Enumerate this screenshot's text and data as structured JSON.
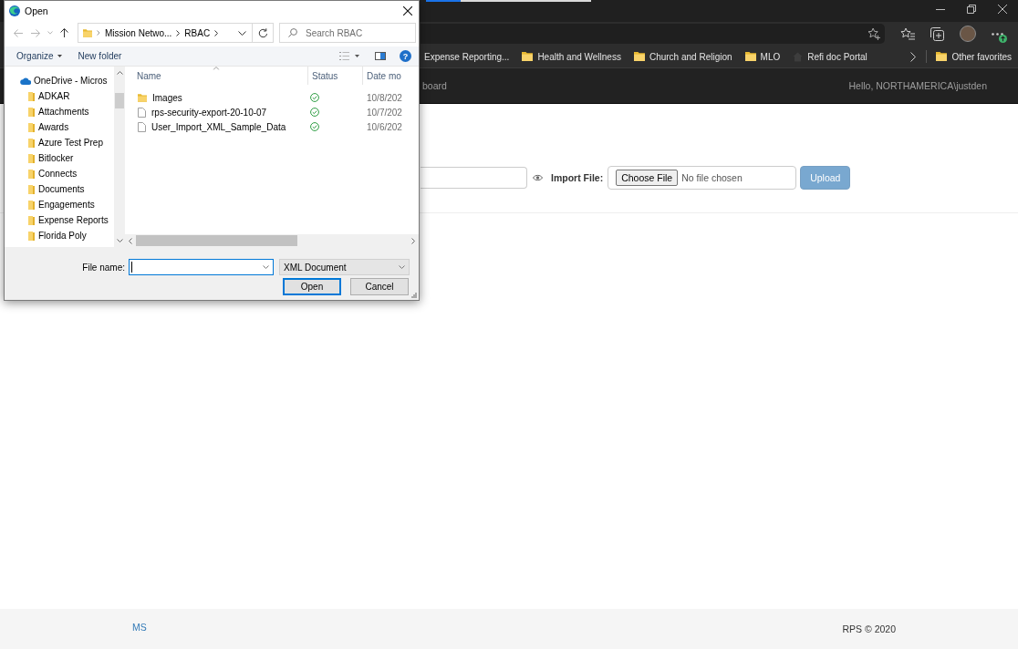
{
  "browser": {
    "loading_bar": {
      "level": 0.21
    },
    "favorites": [
      {
        "label": "Expense Reporting...",
        "kind": "link"
      },
      {
        "label": "Health and Wellness",
        "kind": "folder"
      },
      {
        "label": "Church and Religion",
        "kind": "folder"
      },
      {
        "label": "MLO",
        "kind": "folder"
      },
      {
        "label": "Refi doc Portal",
        "kind": "site"
      }
    ],
    "other_favorites": {
      "label": "Other favorites",
      "kind": "folder"
    }
  },
  "page": {
    "navbar": {
      "brand": "board",
      "greeting": "Hello, NORTHAMERICA\\justden"
    },
    "import_form": {
      "label": "Import File:",
      "choose_button": "Choose File",
      "file_status": "No file chosen",
      "upload": {
        "label": "Upload",
        "disabled": true
      }
    },
    "footer": {
      "link": "MS",
      "copyright": "RPS © 2020"
    }
  },
  "dialog": {
    "title": "Open",
    "path": [
      "Mission Netwo...",
      "RBAC"
    ],
    "search": {
      "placeholder": "Search RBAC"
    },
    "toolbar": [
      {
        "label": "Organize",
        "kind": "menu"
      },
      {
        "label": "New folder",
        "kind": "action"
      }
    ],
    "help": "?",
    "nav_pane": [
      {
        "label": "OneDrive - Micros",
        "kind": "cloud",
        "children": [
          {
            "label": "ADKAR",
            "kind": "folder"
          },
          {
            "label": "Attachments",
            "kind": "folder"
          },
          {
            "label": "Awards",
            "kind": "folder"
          },
          {
            "label": "Azure Test Prep",
            "kind": "folder"
          },
          {
            "label": "Bitlocker",
            "kind": "folder"
          },
          {
            "label": "Connects",
            "kind": "folder"
          },
          {
            "label": "Documents",
            "kind": "folder"
          },
          {
            "label": "Engagements",
            "kind": "folder"
          },
          {
            "label": "Expense Reports",
            "kind": "folder"
          },
          {
            "label": "Florida Poly",
            "kind": "folder"
          }
        ]
      }
    ],
    "columns": [
      {
        "label": "Name",
        "sorted": true
      },
      {
        "label": "Status",
        "sorted": false
      },
      {
        "label": "Date mo",
        "sorted": false
      }
    ],
    "files": [
      {
        "name": "Images",
        "kind": "folder",
        "synced": true,
        "date": "10/8/202"
      },
      {
        "name": "rps-security-export-20-10-07",
        "kind": "file",
        "synced": true,
        "date": "10/7/202"
      },
      {
        "name": "User_Import_XML_Sample_Data",
        "kind": "file",
        "synced": true,
        "date": "10/6/202"
      }
    ],
    "file_name": {
      "label": "File name:",
      "focused": true
    },
    "file_type": "XML Document",
    "buttons": [
      {
        "label": "Open",
        "default": true
      },
      {
        "label": "Cancel",
        "default": false
      }
    ]
  }
}
